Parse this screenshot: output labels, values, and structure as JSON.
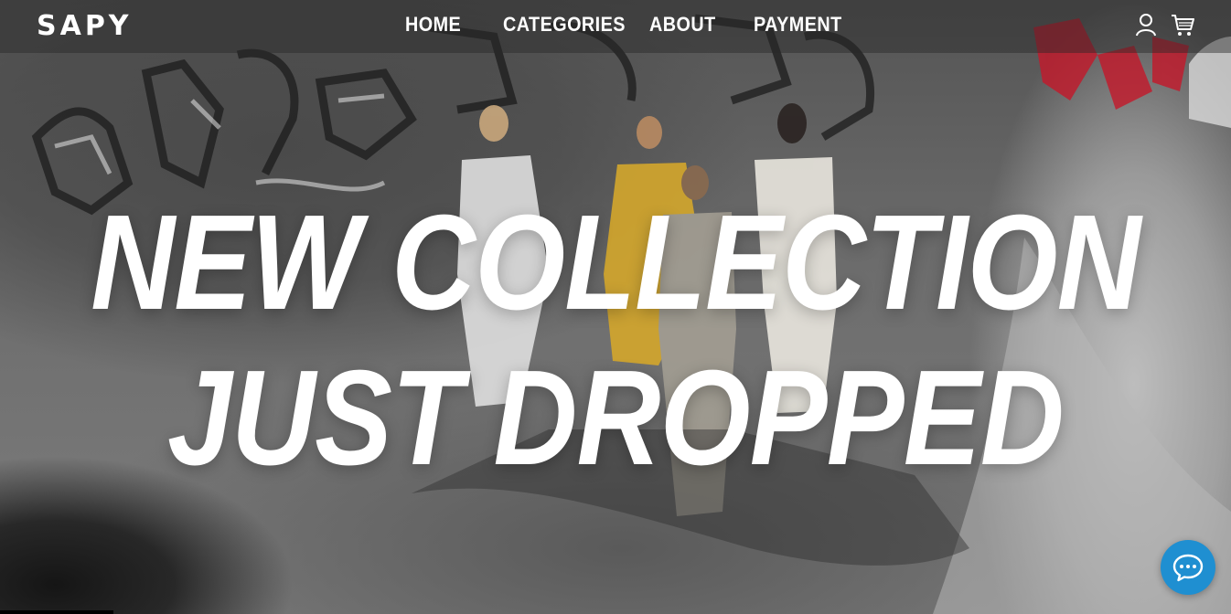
{
  "brand": {
    "logo_text": "SAPY"
  },
  "nav": {
    "items": [
      {
        "label": "HOME"
      },
      {
        "label": "CATEGORIES"
      },
      {
        "label": "ABOUT"
      },
      {
        "label": "PAYMENT"
      }
    ],
    "icons": [
      "user-icon",
      "cart-icon"
    ]
  },
  "hero": {
    "headline_line1": "NEW COLLECTION",
    "headline_line2": "JUST DROPPED",
    "background": "video frame: four women walking in a graffiti-covered concrete skate bowl"
  },
  "chat": {
    "icon": "chat-bubble-icon",
    "color": "#1f8fd1"
  }
}
